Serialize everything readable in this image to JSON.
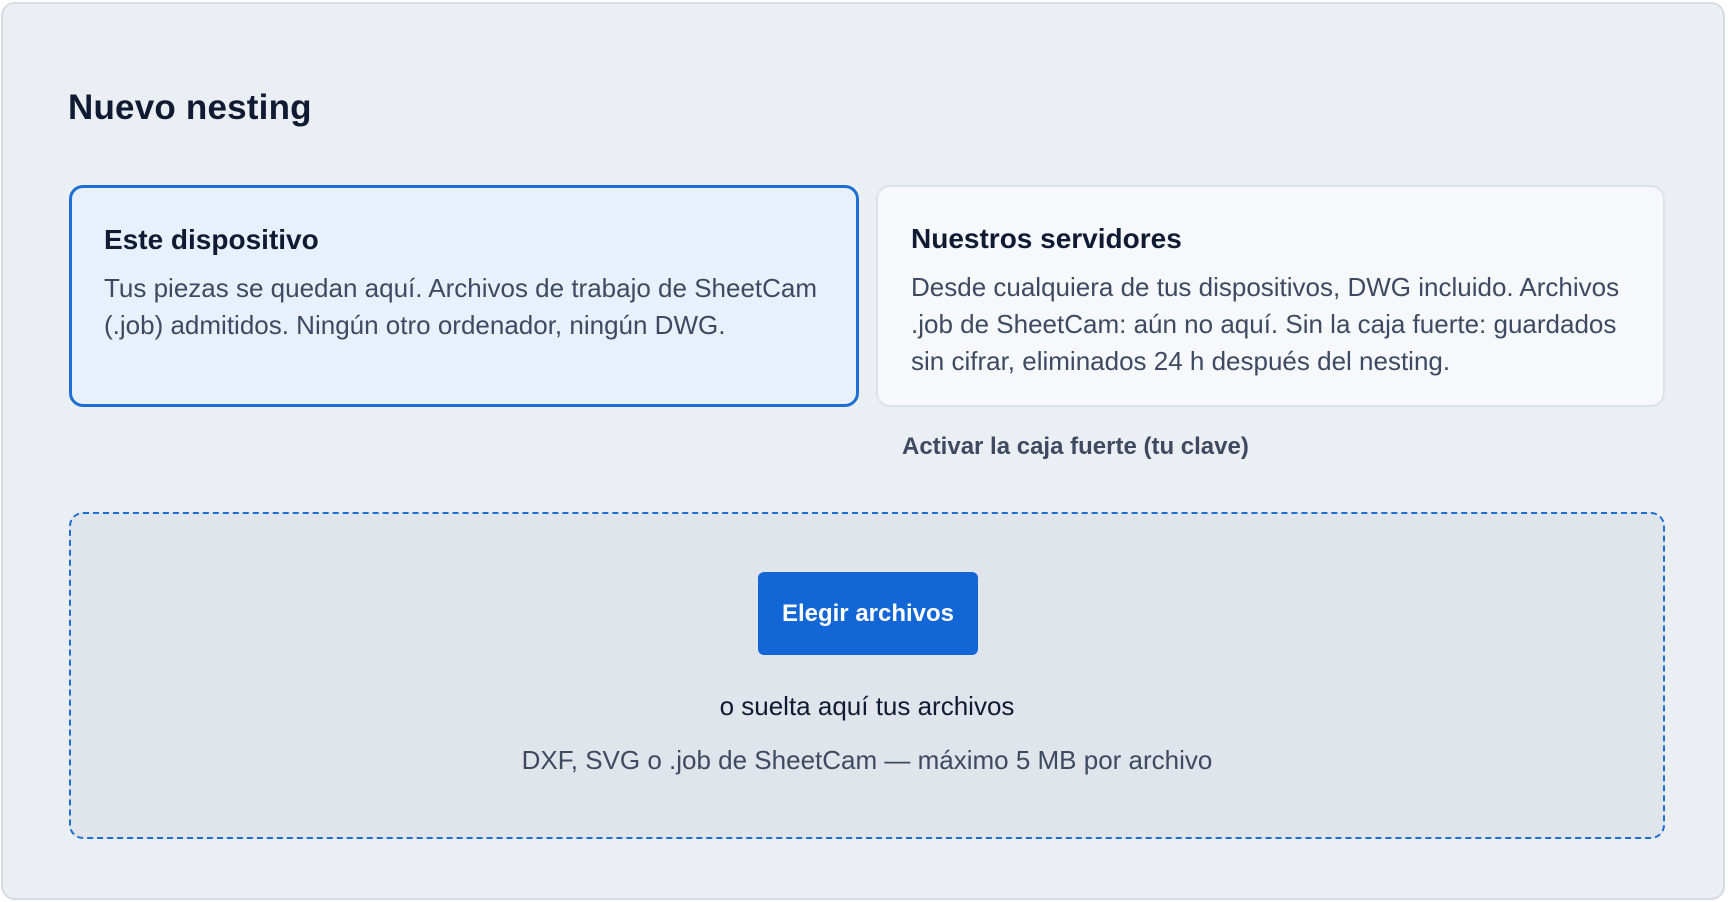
{
  "page": {
    "title": "Nuevo nesting"
  },
  "storage_options": [
    {
      "title": "Este dispositivo",
      "description": "Tus piezas se quedan aquí. Archivos de trabajo de SheetCam (.job) admitidos. Ningún otro ordenador, ningún DWG.",
      "selected": true
    },
    {
      "title": "Nuestros servidores",
      "description": "Desde cualquiera de tus dispositivos, DWG incluido. Archivos .job de SheetCam: aún no aquí. Sin la caja fuerte: guardados sin cifrar, eliminados 24 h después del nesting.",
      "selected": false
    }
  ],
  "vault_link": "Activar la caja fuerte (tu clave)",
  "upload": {
    "button_label": "Elegir archivos",
    "drop_hint": "o suelta aquí tus archivos",
    "formats_hint": "DXF, SVG o .job de SheetCam — máximo 5 MB por archivo"
  },
  "colors": {
    "accent": "#1266d6",
    "selected_card_border": "#1d6fd6",
    "selected_card_bg": "#e8f0fb",
    "panel_bg": "#ebeef3"
  }
}
